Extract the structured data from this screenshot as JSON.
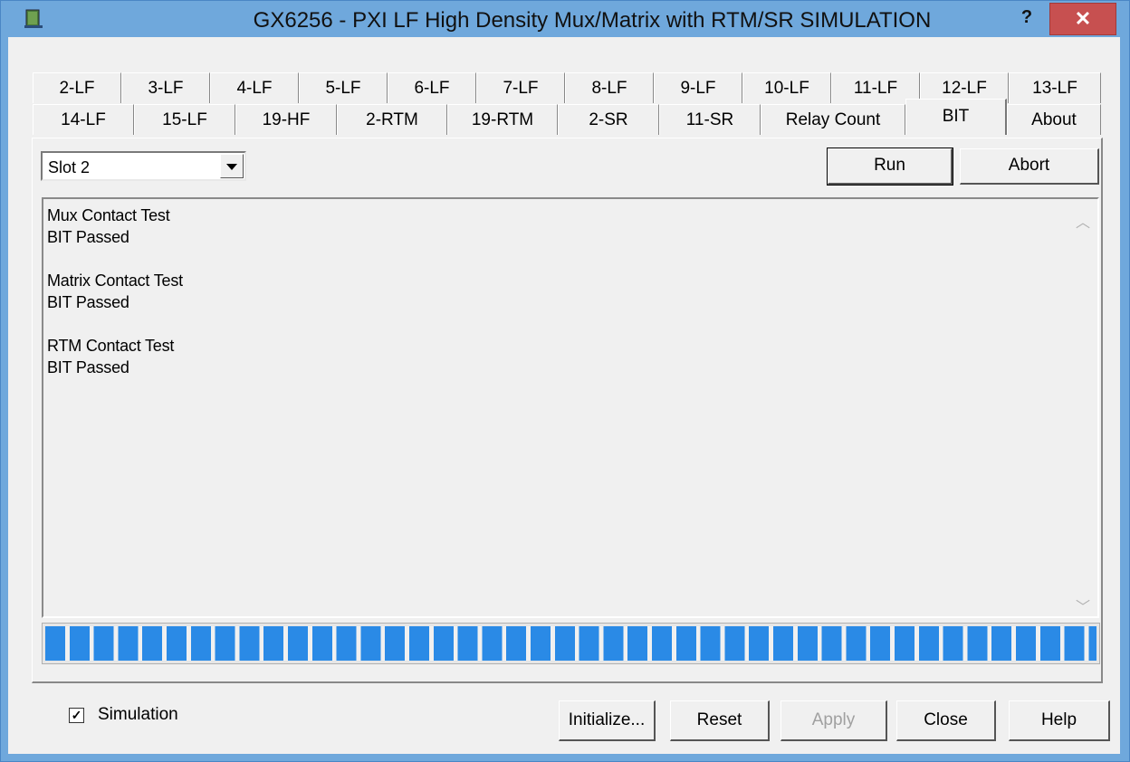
{
  "window": {
    "title": "GX6256 - PXI LF High Density Mux/Matrix with RTM/SR SIMULATION",
    "help_glyph": "?",
    "close_glyph": "✕"
  },
  "tabs": {
    "row_back": [
      "2-LF",
      "3-LF",
      "4-LF",
      "5-LF",
      "6-LF",
      "7-LF",
      "8-LF",
      "9-LF",
      "10-LF",
      "11-LF",
      "12-LF",
      "13-LF"
    ],
    "row_front": [
      "14-LF",
      "15-LF",
      "19-HF",
      "2-RTM",
      "19-RTM",
      "2-SR",
      "11-SR",
      "Relay Count",
      "BIT",
      "About"
    ],
    "active": "BIT"
  },
  "slot_select": {
    "value": "Slot 2"
  },
  "buttons": {
    "run": "Run",
    "abort": "Abort"
  },
  "output": {
    "lines": [
      "Mux Contact Test",
      "BIT Passed",
      "",
      "Matrix Contact Test",
      "BIT Passed",
      "",
      "RTM Contact Test",
      "BIT Passed"
    ]
  },
  "progress": {
    "value_percent": 100
  },
  "footer": {
    "simulation_label": "Simulation",
    "simulation_checked": true,
    "initialize": "Initialize...",
    "reset": "Reset",
    "apply": "Apply",
    "close": "Close",
    "help": "Help"
  },
  "colors": {
    "accent": "#2a8ae6",
    "close_button": "#c75050",
    "title_bar": "#6fa8dc"
  }
}
